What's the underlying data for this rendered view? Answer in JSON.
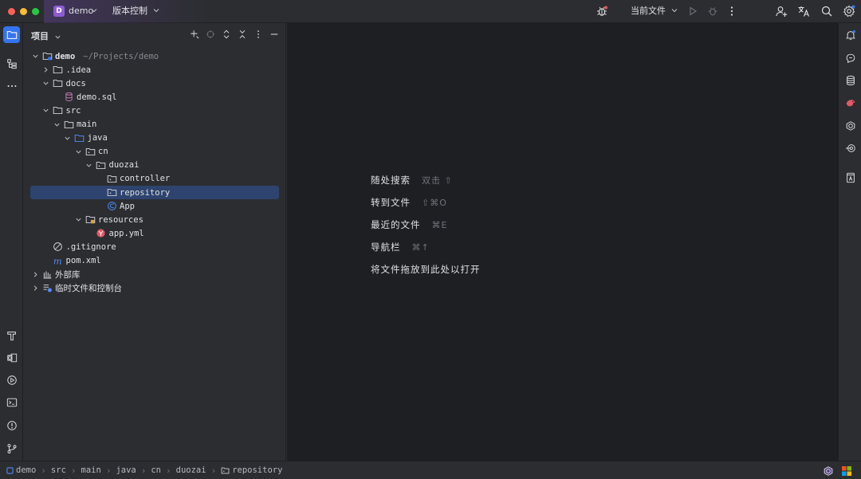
{
  "titlebar": {
    "project_badge": "D",
    "project_name": "demo",
    "vcs_label": "版本控制",
    "run_config_label": "当前文件"
  },
  "project_panel": {
    "title": "项目",
    "tree": [
      {
        "label": "demo",
        "hint": "~/Projects/demo",
        "icon": "module-folder-icon",
        "expanded": true
      },
      {
        "label": ".idea",
        "icon": "folder-icon",
        "expanded": false
      },
      {
        "label": "docs",
        "icon": "folder-icon",
        "expanded": true
      },
      {
        "label": "demo.sql",
        "icon": "sql-file-icon"
      },
      {
        "label": "src",
        "icon": "folder-icon",
        "expanded": true
      },
      {
        "label": "main",
        "icon": "folder-icon",
        "expanded": true
      },
      {
        "label": "java",
        "icon": "source-root-icon",
        "expanded": true
      },
      {
        "label": "cn",
        "icon": "package-icon",
        "expanded": true
      },
      {
        "label": "duozai",
        "icon": "package-icon",
        "expanded": true
      },
      {
        "label": "controller",
        "icon": "package-icon"
      },
      {
        "label": "repository",
        "icon": "package-icon",
        "selected": true
      },
      {
        "label": "App",
        "icon": "java-class-icon"
      },
      {
        "label": "resources",
        "icon": "resources-folder-icon",
        "expanded": true
      },
      {
        "label": "app.yml",
        "icon": "yaml-file-icon"
      },
      {
        "label": ".gitignore",
        "icon": "gitignore-icon"
      },
      {
        "label": "pom.xml",
        "icon": "maven-icon"
      },
      {
        "label": "外部库",
        "icon": "library-icon",
        "expanded": false
      },
      {
        "label": "临时文件和控制台",
        "icon": "scratch-icon",
        "expanded": false
      }
    ]
  },
  "editor": {
    "hints": [
      {
        "label": "随处搜索",
        "key": "双击 ⇧"
      },
      {
        "label": "转到文件",
        "key": "⇧⌘O"
      },
      {
        "label": "最近的文件",
        "key": "⌘E"
      },
      {
        "label": "导航栏",
        "key": "⌘↑"
      },
      {
        "label": "将文件拖放到此处以打开",
        "key": ""
      }
    ]
  },
  "statusbar": {
    "breadcrumb": [
      "demo",
      "src",
      "main",
      "java",
      "cn",
      "duozai",
      "repository"
    ]
  },
  "colors": {
    "accent": "#3574f0",
    "selection": "#2e436e",
    "project_badge": "#8d5cd5",
    "background": "#2b2d30",
    "editor_background": "#1e1f22"
  }
}
